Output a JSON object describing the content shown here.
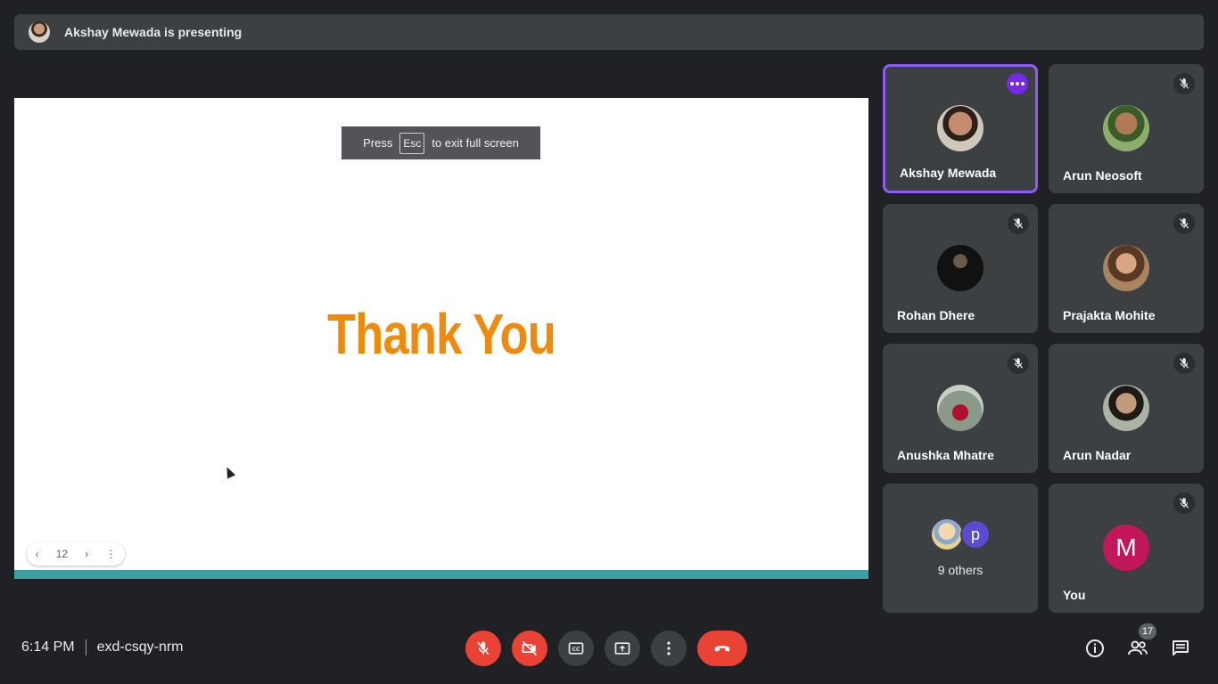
{
  "banner": {
    "presenter_text": "Akshay Mewada is presenting"
  },
  "slide": {
    "title": "Thank You",
    "fullscreen_hint": {
      "press": "Press",
      "key": "Esc",
      "rest": "to exit full screen"
    },
    "pager": {
      "page": "12",
      "prev": "‹",
      "next": "›",
      "menu": "⋮"
    }
  },
  "tiles": [
    {
      "name": "Akshay Mewada"
    },
    {
      "name": "Arun Neosoft"
    },
    {
      "name": "Rohan Dhere"
    },
    {
      "name": "Prajakta Mohite"
    },
    {
      "name": "Anushka Mhatre"
    },
    {
      "name": "Arun Nadar"
    },
    {
      "others_initial": "p",
      "others_label": "9 others"
    },
    {
      "name": "You",
      "initial": "M"
    }
  ],
  "footer": {
    "time": "6:14 PM",
    "meeting_code": "exd-csqy-nrm",
    "participants_count": "17"
  },
  "colors": {
    "background": "#202124",
    "accent_purple": "#8c5cf5",
    "end_call_red": "#ea4335",
    "slide_title_orange": "#f08a0a",
    "slide_stripe_teal": "#3b9ea3"
  }
}
